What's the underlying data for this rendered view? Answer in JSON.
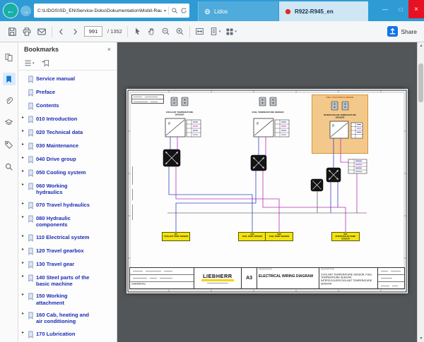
{
  "browser": {
    "address": "C:\\LIDOS\\SD_EN\\Service-Doku\\Dokumentation\\Mobil-Raupenbagger\\S",
    "tabs": [
      {
        "label": "Lidos"
      },
      {
        "label": "R922-R945_en"
      }
    ]
  },
  "toolbar": {
    "page_current": "991",
    "page_total": "/ 1352",
    "share_label": "Share"
  },
  "panel": {
    "title": "Bookmarks",
    "items": [
      {
        "label": "Service manual"
      },
      {
        "label": "Preface"
      },
      {
        "label": "Contents"
      },
      {
        "label": "010 Introduction"
      },
      {
        "label": "020 Technical data"
      },
      {
        "label": "030 Maintenance"
      },
      {
        "label": "040 Drive group"
      },
      {
        "label": "050 Cooling system"
      },
      {
        "label": "060 Working hydraulics"
      },
      {
        "label": "070 Travel hydraulics"
      },
      {
        "label": "080 Hydraulic components"
      },
      {
        "label": "110 Electrical system"
      },
      {
        "label": "120 Travel gearbox"
      },
      {
        "label": "130 Travel gear"
      },
      {
        "label": "140 Steel parts of the basic machine"
      },
      {
        "label": "150 Working attachment"
      },
      {
        "label": "160 Cab, heating and air conditioning"
      },
      {
        "label": "170 Lubrication"
      }
    ]
  },
  "diagram": {
    "sensor_labels": {
      "coolant": "COOLANT TEMPERATURE SENSOR",
      "fuel": "FUEL TEMPERATURE SENSOR",
      "intercooler": "INTERCOOLER TEMPERATURE SENSOR"
    },
    "note": "ONLY FOR STEP II ENGINE",
    "components": [
      {
        "code": "B9",
        "name": "COOLANT TEMP. SENSOR"
      },
      {
        "code": "B10",
        "name": "FUEL TEMP. SENSOR"
      },
      {
        "code": "B48",
        "name": "FUEL TEMP. SENSOR"
      },
      {
        "code": "B47",
        "name": "INTERCOOLER TEMP. SENSOR"
      }
    ],
    "titleblock": {
      "brand": "LIEBHERR",
      "format": "A3",
      "designation_label": "DESIGNATION",
      "designation": "ELECTRICAL WIRING DIAGRAM",
      "description_label": "DESCRIPTION",
      "description": "COOLANT TEMPERATURE SENSOR, FUEL TEMPERATURE SENSOR, INTERCOOLER/COOLANT TEMPERATURE SENSOR",
      "confidential": "CONFIDENTIAL"
    }
  },
  "icons": {
    "back_arrow": "←",
    "forward_arrow": "→",
    "caret_down": "▾",
    "chevron_right": "▸",
    "minimize": "—",
    "maximize": "□",
    "close": "×",
    "scroll_up": "▲",
    "scroll_down": "▼",
    "theta": "ϑ"
  },
  "colors": {
    "titlebar": "#2E9BD5",
    "accent_blue": "#1473E6",
    "highlight_yellow": "#F2E30E",
    "wire_blue": "#3940BF",
    "wire_magenta": "#B52FB5",
    "note_orange": "#F3C98B"
  }
}
